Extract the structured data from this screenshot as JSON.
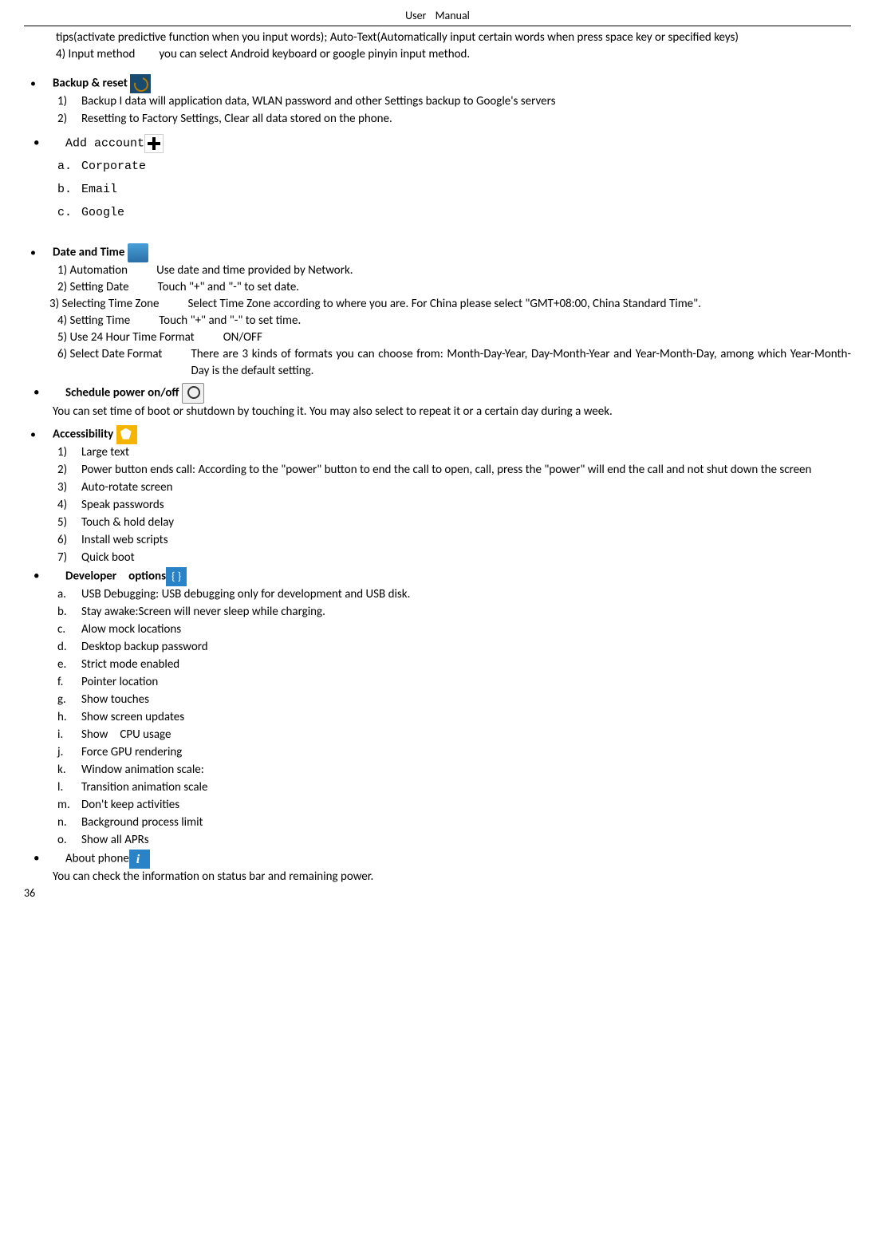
{
  "header": "User  Manual",
  "topText1": "tips(activate predictive function when you input words); Auto-Text(Automatically input certain words when press space key or specified keys)",
  "topText2": "4) Input method  you can select Android keyboard or google pinyin input method.",
  "backup": {
    "title": "Backup & reset",
    "items": [
      {
        "n": "1)",
        "text": "Backup I data will application data, WLAN password and other Settings backup to Google's servers"
      },
      {
        "n": "2)",
        "text": "Resetting to Factory Settings, Clear all data stored on the phone."
      }
    ]
  },
  "addAccount": {
    "title": "Add account",
    "items": [
      {
        "n": "a.",
        "text": "Corporate"
      },
      {
        "n": "b.",
        "text": "Email"
      },
      {
        "n": "c.",
        "text": "Google"
      }
    ]
  },
  "dateTime": {
    "title": "Date and Time",
    "r1a": "1) Automation",
    "r1b": "Use date and time provided by Network.",
    "r2a": "2) Setting Date",
    "r2b": "Touch \"+\" and \"-\" to set date.",
    "r3a": "3) Selecting Time Zone",
    "r3b": "Select Time Zone according to where you are. For China please select \"GMT+08:00, China Standard Time\".",
    "r4a": "4) Setting Time",
    "r4b": "Touch \"+\" and \"-\" to set time.",
    "r5a": "5) Use 24 Hour Time Format",
    "r5b": "ON/OFF",
    "r6a": "6) Select Date Format",
    "r6b": "There are 3 kinds of formats you can choose from: Month-Day-Year, Day-Month-Year and Year-Month-Day, among which Year-Month-Day is the default setting."
  },
  "schedule": {
    "title": "Schedule power on/off",
    "desc": "You can set time of boot or shutdown by touching it. You may also select to repeat it or a certain day during a week."
  },
  "accessibility": {
    "title": "Accessibility",
    "items": [
      {
        "n": "1)",
        "text": "Large text"
      },
      {
        "n": "2)",
        "text": "Power button ends call: According to the \"power\" button to end the call to open, call, press the \"power\" will end the call and not shut down the screen"
      },
      {
        "n": "3)",
        "text": "Auto-rotate screen"
      },
      {
        "n": "4)",
        "text": "Speak passwords"
      },
      {
        "n": "5)",
        "text": "Touch & hold delay"
      },
      {
        "n": "6)",
        "text": "Install web scripts"
      },
      {
        "n": "7)",
        "text": "Quick boot"
      }
    ]
  },
  "dev": {
    "title": "Developer options",
    "items": [
      {
        "n": "a.",
        "label": "USB Debugging: ",
        "text": "USB debugging only for development and USB disk."
      },
      {
        "n": "b.",
        "text": "Stay awake:Screen will never sleep while charging."
      },
      {
        "n": "c.",
        "text": "Alow mock locations"
      },
      {
        "n": "d.",
        "text": "Desktop backup password"
      },
      {
        "n": "e.",
        "text": "Strict mode enabled"
      },
      {
        "n": "f.",
        "text": "Pointer location"
      },
      {
        "n": "g.",
        "text": "Show touches"
      },
      {
        "n": "h.",
        "text": "Show screen updates"
      },
      {
        "n": "i.",
        "text": "Show CPU usage"
      },
      {
        "n": "j.",
        "text": "Force GPU rendering"
      },
      {
        "n": "k.",
        "text": "Window animation scale:"
      },
      {
        "n": "l.",
        "text": "Transition animation scale"
      },
      {
        "n": "m.",
        "text": "Don't keep activities"
      },
      {
        "n": "n.",
        "text": "Background process limit"
      },
      {
        "n": "o.",
        "text": "Show all APRs"
      }
    ]
  },
  "about": {
    "title": "About phone",
    "desc": "You can check the information on status bar and remaining power."
  },
  "pageNum": "36"
}
